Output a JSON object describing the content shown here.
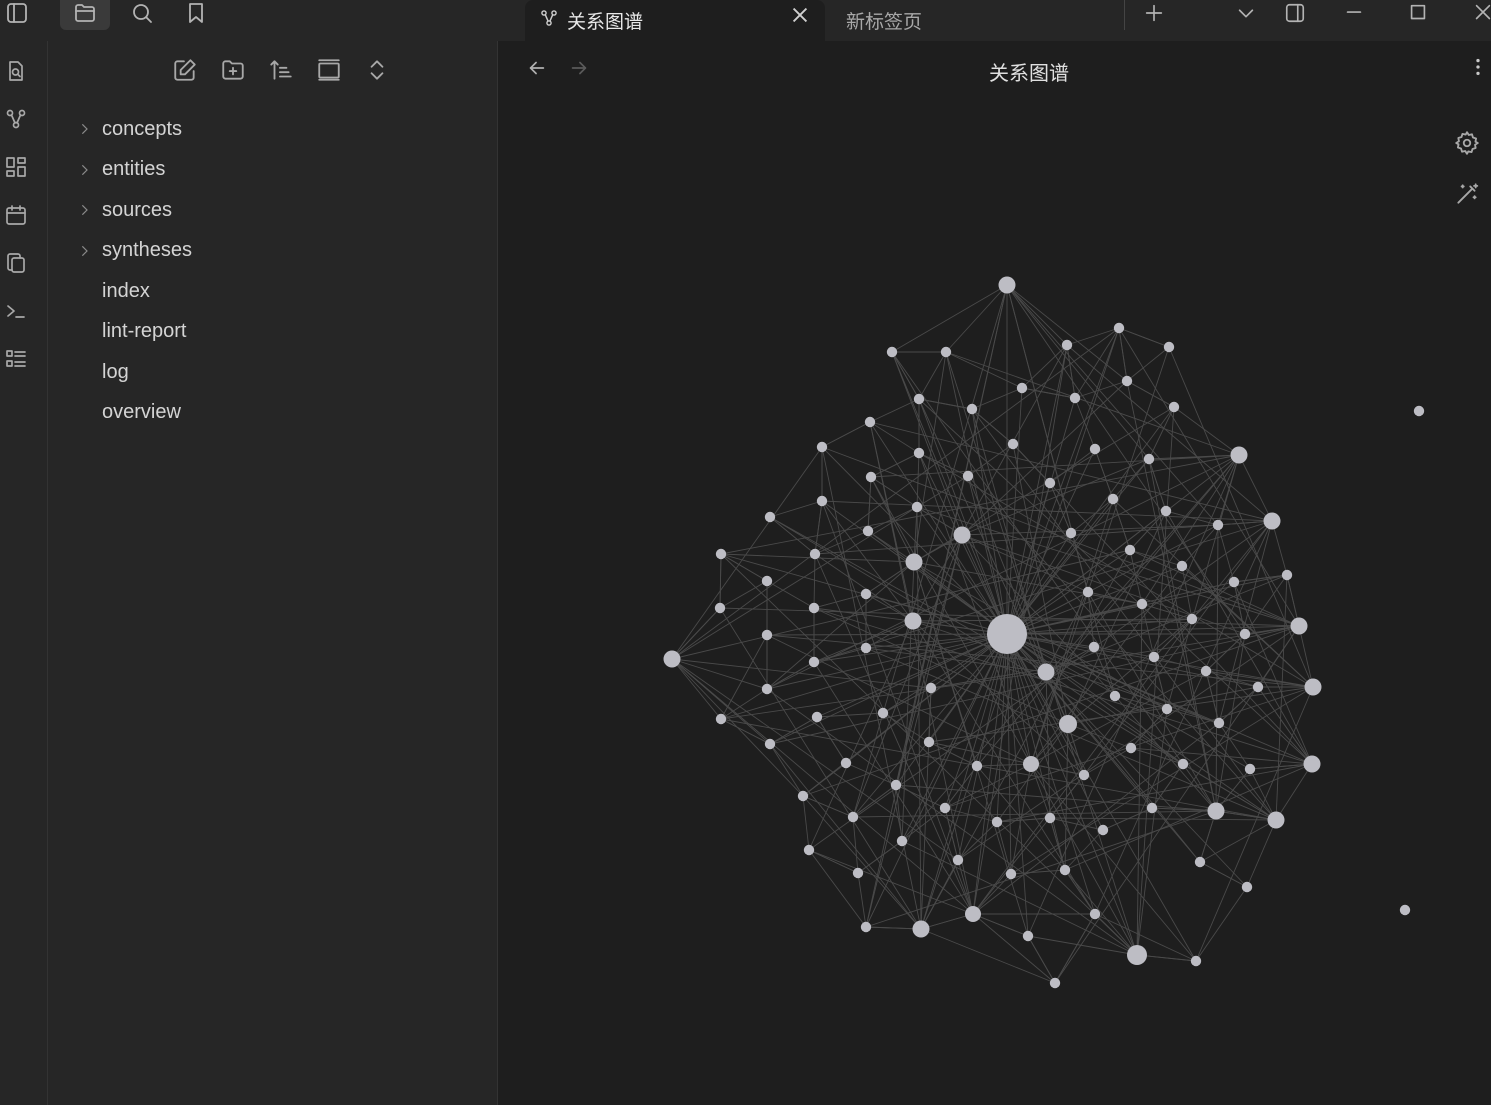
{
  "tabs": [
    {
      "title": "关系图谱",
      "icon": "graph-icon",
      "active": true
    },
    {
      "title": "新标签页",
      "active": false
    }
  ],
  "explorer": {
    "items": [
      {
        "label": "concepts",
        "folder": true
      },
      {
        "label": "entities",
        "folder": true
      },
      {
        "label": "sources",
        "folder": true
      },
      {
        "label": "syntheses",
        "folder": true
      },
      {
        "label": "index",
        "folder": false
      },
      {
        "label": "lint-report",
        "folder": false
      },
      {
        "label": "log",
        "folder": false
      },
      {
        "label": "overview",
        "folder": false
      }
    ]
  },
  "main": {
    "title": "关系图谱"
  },
  "colors": {
    "background": "#1e1e1e",
    "panel": "#262626",
    "node": "#bdbdc4",
    "edge": "#4a4a4a"
  }
}
